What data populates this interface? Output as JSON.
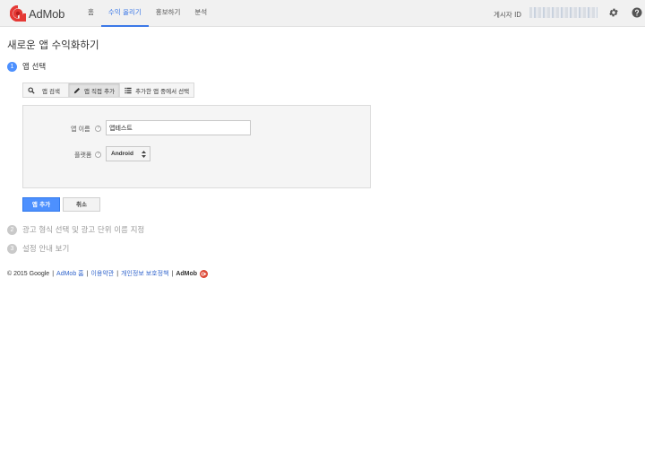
{
  "header": {
    "logo_text": "AdMob",
    "nav": [
      "홈",
      "수익 올리기",
      "홍보하기",
      "분석"
    ],
    "active_nav_index": 1,
    "publisher_label": "게시자 ID",
    "icons": [
      "admob-logo-icon",
      "gear-icon",
      "help-icon"
    ]
  },
  "page": {
    "title": "새로운 앱 수익화하기"
  },
  "steps": [
    {
      "number": "1",
      "label": "앱 선택",
      "state": "active"
    },
    {
      "number": "2",
      "label": "광고 형식 선택 및 광고 단위 이름 지정",
      "state": "inactive"
    },
    {
      "number": "3",
      "label": "설정 안내 보기",
      "state": "inactive"
    }
  ],
  "tabs": [
    {
      "label": "앱 검색",
      "icon": "search-icon",
      "active": false
    },
    {
      "label": "앱 직접 추가",
      "icon": "pencil-icon",
      "active": true
    },
    {
      "label": "추가한 앱 중에서 선택",
      "icon": "list-icon",
      "active": false
    }
  ],
  "form": {
    "app_name_label": "앱 이름",
    "app_name_value": "앱테스트",
    "platform_label": "플랫폼",
    "platform_value": "Android",
    "help_glyph": "?"
  },
  "buttons": {
    "add": "앱 추가",
    "cancel": "취소"
  },
  "footer": {
    "copyright": "© 2015 Google",
    "links": [
      "AdMob 홈",
      "이용약관",
      "개인정보 보호정책"
    ],
    "brand": "AdMob",
    "separator": "|"
  },
  "colors": {
    "accent": "#4d90fe",
    "nav_active": "#3b78e7",
    "logo_red": "#e53935",
    "link": "#3366cc",
    "gplus": "#dd4b39"
  }
}
